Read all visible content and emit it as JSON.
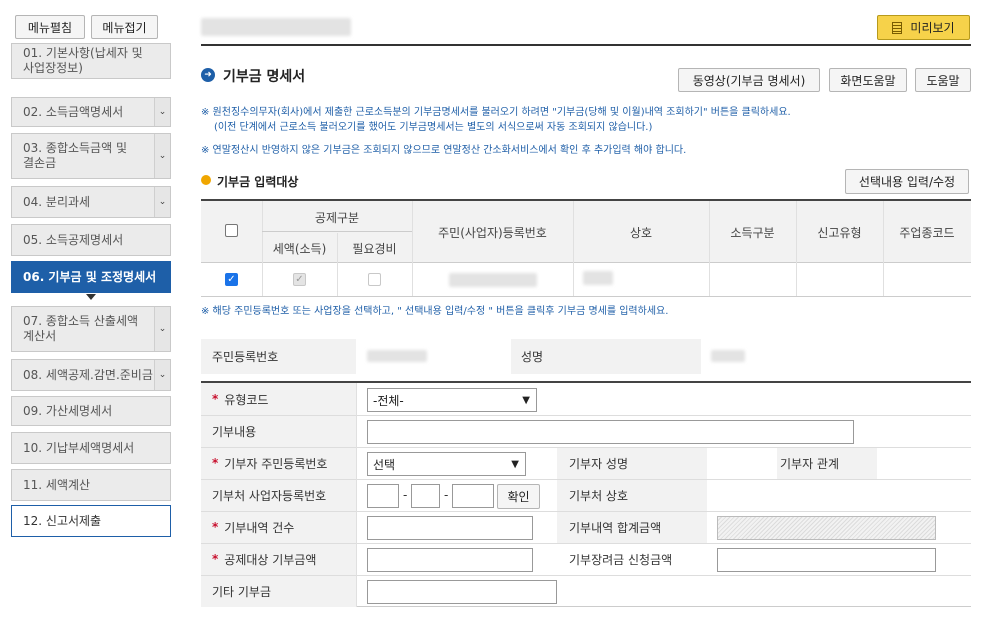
{
  "sidebar": {
    "expand_label": "메뉴펼침",
    "collapse_label": "메뉴접기",
    "items": [
      {
        "label": "01. 기본사항(납세자 및 사업장정보)"
      },
      {
        "label": "02. 소득금액명세서"
      },
      {
        "label": "03. 종합소득금액 및 결손금"
      },
      {
        "label": "04. 분리과세"
      },
      {
        "label": "05. 소득공제명세서"
      },
      {
        "label": "06. 기부금 및 조정명세서"
      },
      {
        "label": "07. 종합소득 산출세액계산서"
      },
      {
        "label": "08. 세액공제.감면.준비금"
      },
      {
        "label": "09. 가산세명세서"
      },
      {
        "label": "10. 기납부세액명세서"
      },
      {
        "label": "11. 세액계산"
      },
      {
        "label": "12. 신고서제출"
      }
    ]
  },
  "header": {
    "preview_label": "미리보기",
    "section_title": "기부금 명세서",
    "video_label": "동영상(기부금 명세서)",
    "screen_help_label": "화면도움말",
    "help_label": "도움말"
  },
  "notes": {
    "note1": "※ 원천징수의무자(회사)에서 제출한 근로소득분의 기부금명세서를 불러오기 하려면 \"기부금(당해 및 이월)내역 조회하기\" 버튼을 클릭하세요.",
    "note1b": "(이전 단계에서 근로소득 불러오기를 했어도 기부금명세서는 별도의 서식으로써 자동 조회되지 않습니다.)",
    "note2": "※ 연말정산시 반영하지 않은 기부금은 조회되지 않으므로 연말정산 간소화서비스에서 확인 후 추가입력 해야 합니다.",
    "note3": "※ 해당 주민등록번호 또는 사업장을 선택하고, \" 선택내용 입력/수정 \" 버튼을 클릭후 기부금 명세를 입력하세요."
  },
  "target": {
    "title": "기부금 입력대상",
    "edit_label": "선택내용 입력/수정",
    "headers": {
      "deduction": "공제구분",
      "tax": "세액(소득)",
      "expense": "필요경비",
      "regno": "주민(사업자)등록번호",
      "name": "상호",
      "income": "소득구분",
      "report": "신고유형",
      "code": "주업종코드"
    },
    "row": {
      "selected": true,
      "tax": true,
      "expense": false
    }
  },
  "info": {
    "regno_label": "주민등록번호",
    "name_label": "성명"
  },
  "form": {
    "type_code_label": "유형코드",
    "type_code_value": "-전체-",
    "content_label": "기부내용",
    "donor_regno_label": "기부자 주민등록번호",
    "donor_regno_value": "선택",
    "donor_name_label": "기부자 성명",
    "donor_relation_label": "기부자 관계",
    "org_bizno_label": "기부처 사업자등록번호",
    "dash": "-",
    "confirm_label": "확인",
    "org_name_label": "기부처 상호",
    "count_label": "기부내역 건수",
    "total_label": "기부내역 합계금액",
    "deduct_amount_label": "공제대상 기부금액",
    "scholarship_label": "기부장려금 신청금액",
    "other_label": "기타 기부금"
  },
  "colors": {
    "accent": "#1e5fa8",
    "required": "#c8102e",
    "preview_bg": "#f6d24a"
  }
}
